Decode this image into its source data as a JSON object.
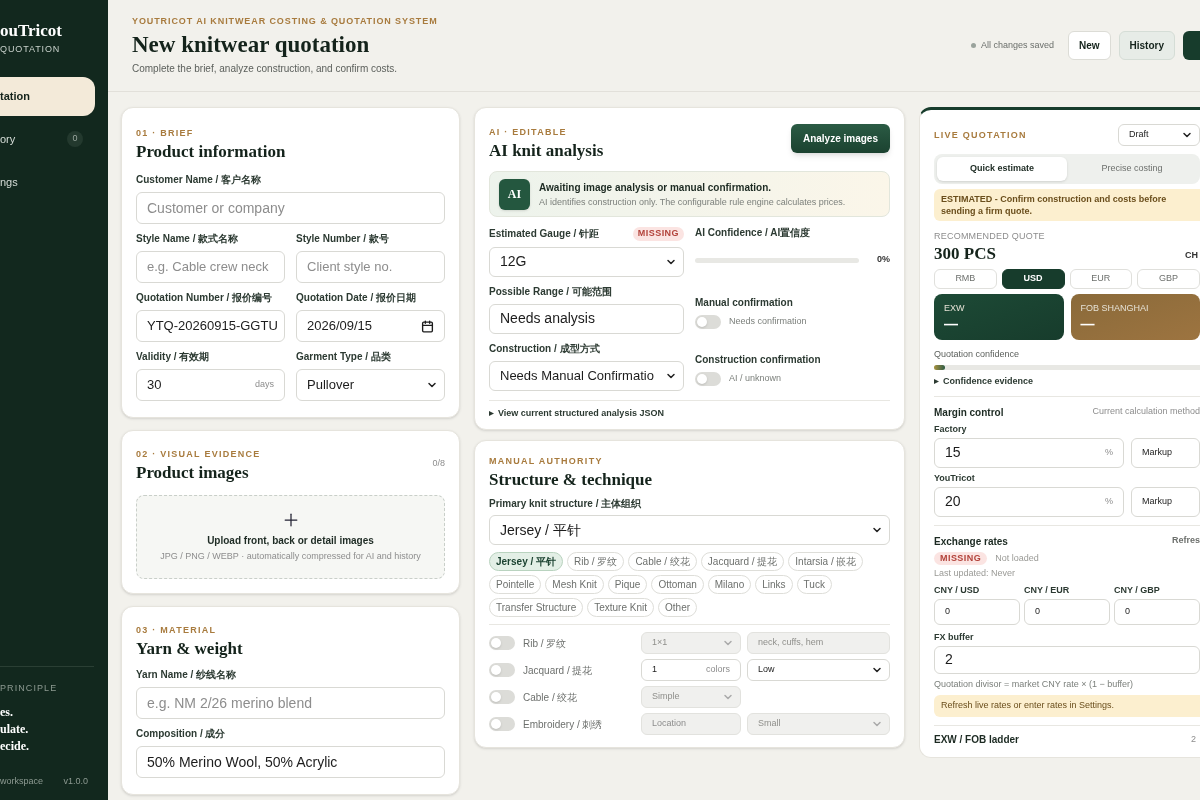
{
  "sidebar": {
    "brand": "ouTricot",
    "brand_sub": "QUOTATION",
    "nav": [
      {
        "label": "tation",
        "selected": true
      },
      {
        "label": "ory",
        "count": "0",
        "selected": false
      },
      {
        "label": "ngs",
        "selected": false
      }
    ],
    "principle_title": "PRINCIPLE",
    "principle_lines": [
      "es.",
      "ulate.",
      "ecide."
    ],
    "workspace": "workspace",
    "version": "v1.0.0"
  },
  "header": {
    "eyebrow": "YOUTRICOT AI KNITWEAR COSTING & QUOTATION SYSTEM",
    "title": "New knitwear quotation",
    "subtitle": "Complete the brief, analyze construction, and confirm costs.",
    "save_status": "All changes saved",
    "actions": [
      {
        "label": "New",
        "kind": "outline"
      },
      {
        "label": "History",
        "kind": "soft"
      }
    ]
  },
  "brief": {
    "eyebrow": "01 · BRIEF",
    "title": "Product information",
    "rows": [
      [
        {
          "label": "Customer Name / 客户名称",
          "kind": "text",
          "placeholder": "Customer or company"
        }
      ],
      [
        {
          "label": "Style Name / 款式名称",
          "kind": "text",
          "placeholder": "e.g. Cable crew neck"
        },
        {
          "label": "Style Number / 款号",
          "kind": "text",
          "placeholder": "Client style no."
        }
      ],
      [
        {
          "label": "Quotation Number / 报价编号",
          "kind": "text",
          "value": "YTQ-20260915-GGTU"
        },
        {
          "label": "Quotation Date / 报价日期",
          "kind": "date",
          "value": "2026/09/15"
        }
      ],
      [
        {
          "label": "Validity / 有效期",
          "kind": "unit",
          "value": "30",
          "unit": "days"
        },
        {
          "label": "Garment Type / 品类",
          "kind": "select",
          "value": "Pullover"
        }
      ]
    ]
  },
  "images": {
    "eyebrow": "02 · VISUAL EVIDENCE",
    "title": "Product images",
    "count": "0/8",
    "upload_title": "Upload front, back or detail images",
    "upload_hint": "JPG / PNG / WEBP · automatically compressed for AI and history"
  },
  "material": {
    "eyebrow": "03 · MATERIAL",
    "title": "Yarn & weight",
    "rows": [
      [
        {
          "label": "Yarn Name / 纱线名称",
          "kind": "text",
          "placeholder": "e.g. NM 2/26 merino blend"
        }
      ],
      [
        {
          "label": "Composition / 成分",
          "kind": "text",
          "value": "50% Merino Wool, 50% Acrylic"
        }
      ]
    ]
  },
  "analysis": {
    "eyebrow": "AI · EDITABLE",
    "title": "AI knit analysis",
    "action": "Analyze images",
    "banner": {
      "badge": "AI",
      "title": "Awaiting image analysis or manual confirmation.",
      "text": "AI identifies construction only. The configurable rule engine calculates prices."
    },
    "gauge": {
      "label": "Estimated Gauge / 针距",
      "badge": "MISSING",
      "kind": "select",
      "value": "12G"
    },
    "confidence": {
      "label": "AI Confidence / AI置信度",
      "level": 0,
      "reading": "0%"
    },
    "range": {
      "label": "Possible Range / 可能范围",
      "kind": "text",
      "value": "Needs analysis"
    },
    "manual_confirmation": {
      "label": "Manual confirmation",
      "on": false,
      "text": "Needs confirmation"
    },
    "construction": {
      "label": "Construction / 成型方式",
      "kind": "select",
      "value": "Needs Manual Confirmatio"
    },
    "construction_confirmation": {
      "label": "Construction confirmation",
      "on": false,
      "text": "AI / unknown"
    },
    "json_toggle": {
      "label": "View current structured analysis JSON",
      "expanded": false
    }
  },
  "structure": {
    "eyebrow": "MANUAL AUTHORITY",
    "title": "Structure & technique",
    "primary_label": "Primary knit structure / 主体组织",
    "primary": {
      "kind": "select",
      "value": "Jersey / 平针"
    },
    "chips": [
      {
        "label": "Jersey / 平针",
        "selected": true
      },
      {
        "label": "Rib / 罗纹",
        "selected": false
      },
      {
        "label": "Cable / 绞花",
        "selected": false
      },
      {
        "label": "Jacquard / 提花",
        "selected": false
      },
      {
        "label": "Intarsia / 嵌花",
        "selected": false
      },
      {
        "label": "Pointelle",
        "selected": false
      },
      {
        "label": "Mesh Knit",
        "selected": false
      },
      {
        "label": "Pique",
        "selected": false
      },
      {
        "label": "Ottoman",
        "selected": false
      },
      {
        "label": "Milano",
        "selected": false
      },
      {
        "label": "Links",
        "selected": false
      },
      {
        "label": "Tuck",
        "selected": false
      },
      {
        "label": "Transfer Structure",
        "selected": false
      },
      {
        "label": "Texture Knit",
        "selected": false
      },
      {
        "label": "Other",
        "selected": false
      }
    ],
    "techniques": [
      {
        "label": "Rib / 罗纹",
        "on": false,
        "controls": [
          {
            "kind": "select",
            "value": "1×1",
            "disabled": true
          },
          {
            "kind": "text",
            "value": "neck, cuffs, hem",
            "disabled": true
          }
        ]
      },
      {
        "label": "Jacquard / 提花",
        "on": false,
        "controls": [
          {
            "kind": "unit",
            "value": "1",
            "unit": "colors",
            "disabled": false
          },
          {
            "kind": "select",
            "value": "Low",
            "disabled": false
          }
        ]
      },
      {
        "label": "Cable / 绞花",
        "on": false,
        "controls": [
          {
            "kind": "select",
            "value": "Simple",
            "disabled": true
          }
        ]
      },
      {
        "label": "Embroidery / 刺绣",
        "on": false,
        "controls": [
          {
            "kind": "text",
            "placeholder": "Location",
            "disabled": true
          },
          {
            "kind": "select",
            "value": "Small",
            "disabled": true
          }
        ]
      }
    ]
  },
  "quotation": {
    "eyebrow": "LIVE QUOTATION",
    "status": {
      "kind": "select",
      "value": "Draft"
    },
    "modes": [
      {
        "label": "Quick estimate",
        "selected": true
      },
      {
        "label": "Precise costing",
        "selected": false
      }
    ],
    "notice": "ESTIMATED - Confirm construction and costs before sending a firm quote.",
    "recommended_label": "RECOMMENDED QUOTE",
    "quantity": "300 PCS",
    "side_label": "CH",
    "currencies": [
      {
        "label": "RMB",
        "selected": false
      },
      {
        "label": "USD",
        "selected": true
      },
      {
        "label": "EUR",
        "selected": false
      },
      {
        "label": "GBP",
        "selected": false
      }
    ],
    "prices": [
      {
        "label": "EXW",
        "value": "—",
        "kind": "exw"
      },
      {
        "label": "FOB SHANGHAI",
        "value": "—",
        "kind": "fob"
      }
    ],
    "confidence": {
      "label": "Quotation confidence",
      "level": 0.04
    },
    "evidence": {
      "label": "Confidence evidence",
      "expanded": false
    },
    "margin": {
      "title": "Margin control",
      "note": "Current calculation method",
      "rows": [
        {
          "label": "Factory",
          "value": "15",
          "unit": "%",
          "method": "Markup"
        },
        {
          "label": "YouTricot",
          "value": "20",
          "unit": "%",
          "method": "Markup"
        }
      ]
    },
    "exchange": {
      "title": "Exchange rates",
      "action": "Refres",
      "badge": "MISSING",
      "status": "Not loaded",
      "updated": "Last updated: Never",
      "rates": [
        {
          "label": "CNY / USD",
          "value": "0"
        },
        {
          "label": "CNY / EUR",
          "value": "0"
        },
        {
          "label": "CNY / GBP",
          "value": "0"
        }
      ],
      "buffer_label": "FX buffer",
      "buffer": "2",
      "formula": "Quotation divisor = market CNY rate × (1 − buffer)",
      "warning": "Refresh live rates or enter rates in Settings."
    },
    "ladder": {
      "title": "EXW / FOB ladder",
      "note": "2"
    }
  }
}
